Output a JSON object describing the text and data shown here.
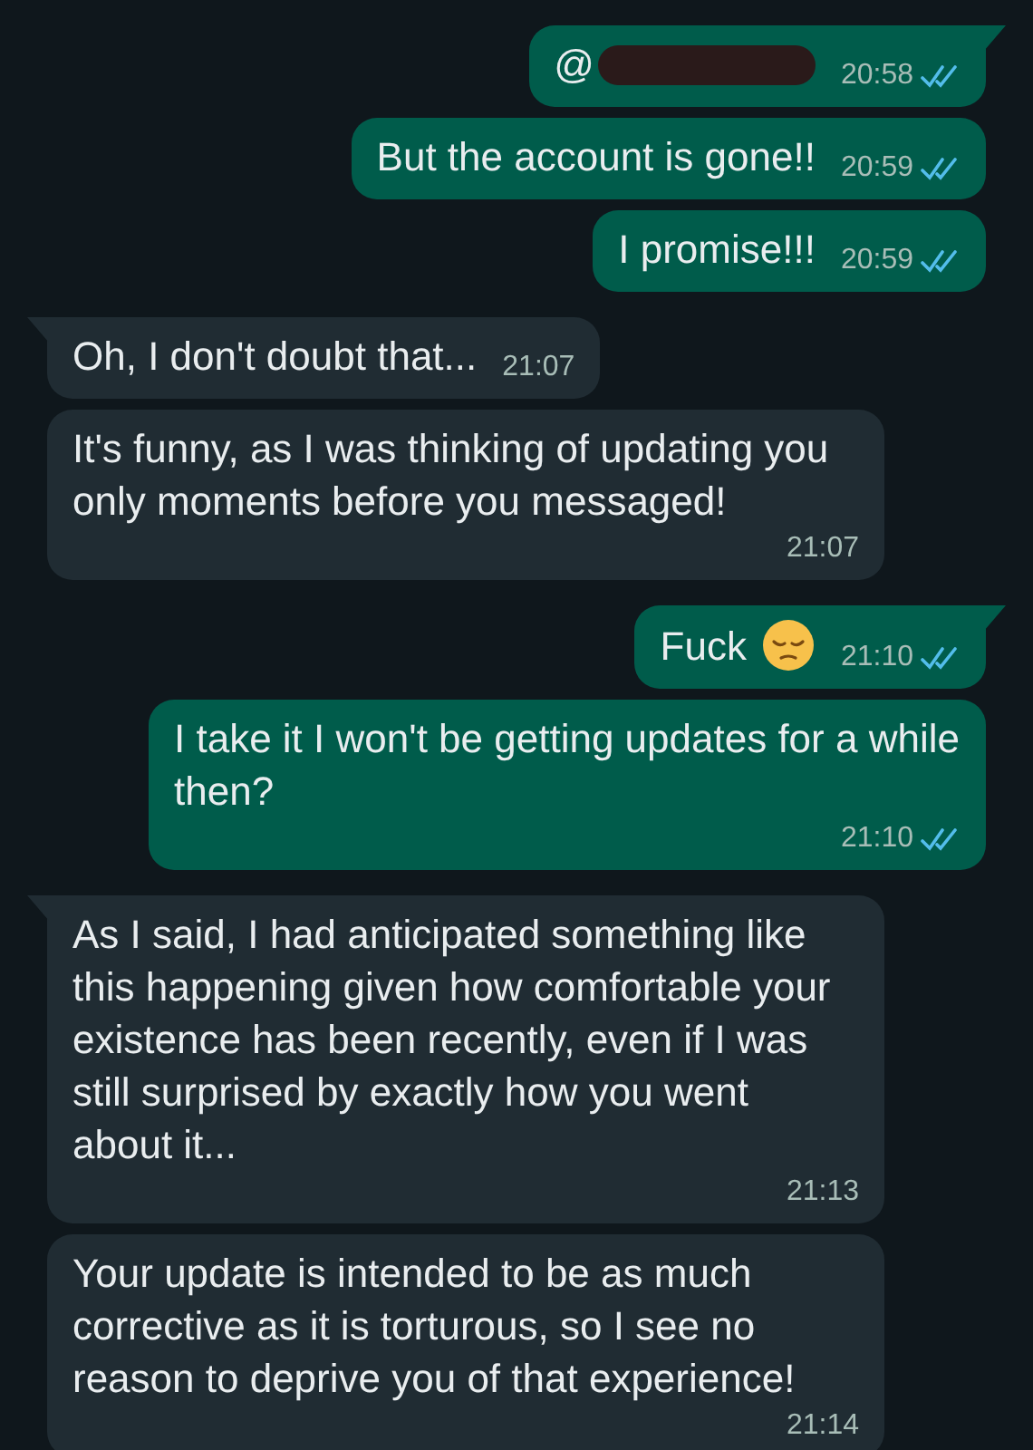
{
  "messages": [
    {
      "kind": "outgoing",
      "text": "@",
      "redacted": true,
      "time": "20:58",
      "read": true,
      "tail": true
    },
    {
      "kind": "outgoing",
      "text": "But the account is gone!!",
      "time": "20:59",
      "read": true,
      "tail": false
    },
    {
      "kind": "outgoing",
      "text": "I promise!!!",
      "time": "20:59",
      "read": true,
      "tail": false
    },
    {
      "kind": "incoming",
      "text": "Oh, I don't doubt that...",
      "time": "21:07",
      "tail": true
    },
    {
      "kind": "incoming",
      "text": "It's funny, as I was thinking of updating you only moments before you messaged!",
      "time": "21:07",
      "tail": false
    },
    {
      "kind": "outgoing",
      "text": "Fuck",
      "emoji": {
        "kind": "pensive"
      },
      "time": "21:10",
      "read": true,
      "tail": true
    },
    {
      "kind": "outgoing",
      "text": "I take it I won't be getting updates for a while then?",
      "time": "21:10",
      "read": true,
      "tail": false
    },
    {
      "kind": "incoming",
      "text": "As I said, I had anticipated something like this happening given how comfortable your existence has been recently, even if I was still surprised by exactly how you went about it...",
      "time": "21:13",
      "tail": true
    },
    {
      "kind": "incoming",
      "text": "Your update is intended to be as much corrective as it is torturous, so I see no reason to deprive you of that experience!",
      "time": "21:14",
      "tail": false
    }
  ]
}
